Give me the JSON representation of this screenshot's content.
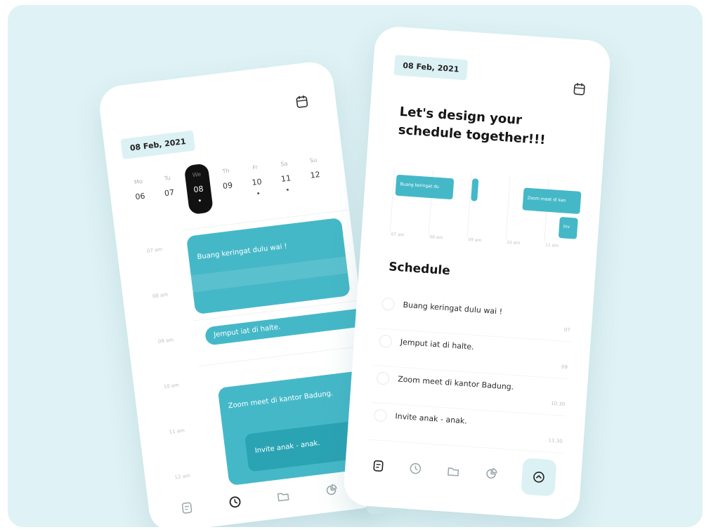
{
  "left_phone": {
    "date": "08 Feb, 2021",
    "days": [
      {
        "name": "Mo",
        "num": "06",
        "dot": false,
        "active": false
      },
      {
        "name": "Tu",
        "num": "07",
        "dot": false,
        "active": false
      },
      {
        "name": "We",
        "num": "08",
        "dot": true,
        "active": true
      },
      {
        "name": "Th",
        "num": "09",
        "dot": false,
        "active": false
      },
      {
        "name": "Fr",
        "num": "10",
        "dot": true,
        "active": false
      },
      {
        "name": "Sa",
        "num": "11",
        "dot": true,
        "active": false
      },
      {
        "name": "Su",
        "num": "12",
        "dot": false,
        "active": false
      }
    ],
    "hours": [
      "07 am",
      "08 am",
      "09 am",
      "10 am",
      "11 am",
      "12 am"
    ],
    "events": [
      "Buang keringat dulu wai !",
      "Jemput iat di halte.",
      "Zoom meet di kantor Badung.",
      "Invite anak - anak."
    ]
  },
  "right_phone": {
    "date": "08 Feb, 2021",
    "headline_line1": "Let's design your",
    "headline_line2": "schedule together!!!",
    "mini_labels": [
      "07 am",
      "08 am",
      "09 am",
      "10 am",
      "11 am"
    ],
    "mini_events": [
      "Buang keringat du",
      "Zoom meet di kan",
      "Inv"
    ],
    "schedule_title": "Schedule",
    "schedule": [
      {
        "text": "Buang keringat dulu wai !",
        "time": "07"
      },
      {
        "text": "Jemput iat di halte.",
        "time": "09"
      },
      {
        "text": "Zoom meet di kantor Badung.",
        "time": "10.30"
      },
      {
        "text": "Invite anak - anak.",
        "time": "11.30"
      }
    ]
  },
  "nav_icons": [
    "notes-icon",
    "clock-icon",
    "folder-icon",
    "pie-chart-icon",
    "chevron-up-icon"
  ],
  "colors": {
    "accent": "#45b8c8",
    "accent_dark": "#2aa3b3",
    "chip_bg": "#dcf1f4",
    "page_bg": "#dff2f5"
  }
}
